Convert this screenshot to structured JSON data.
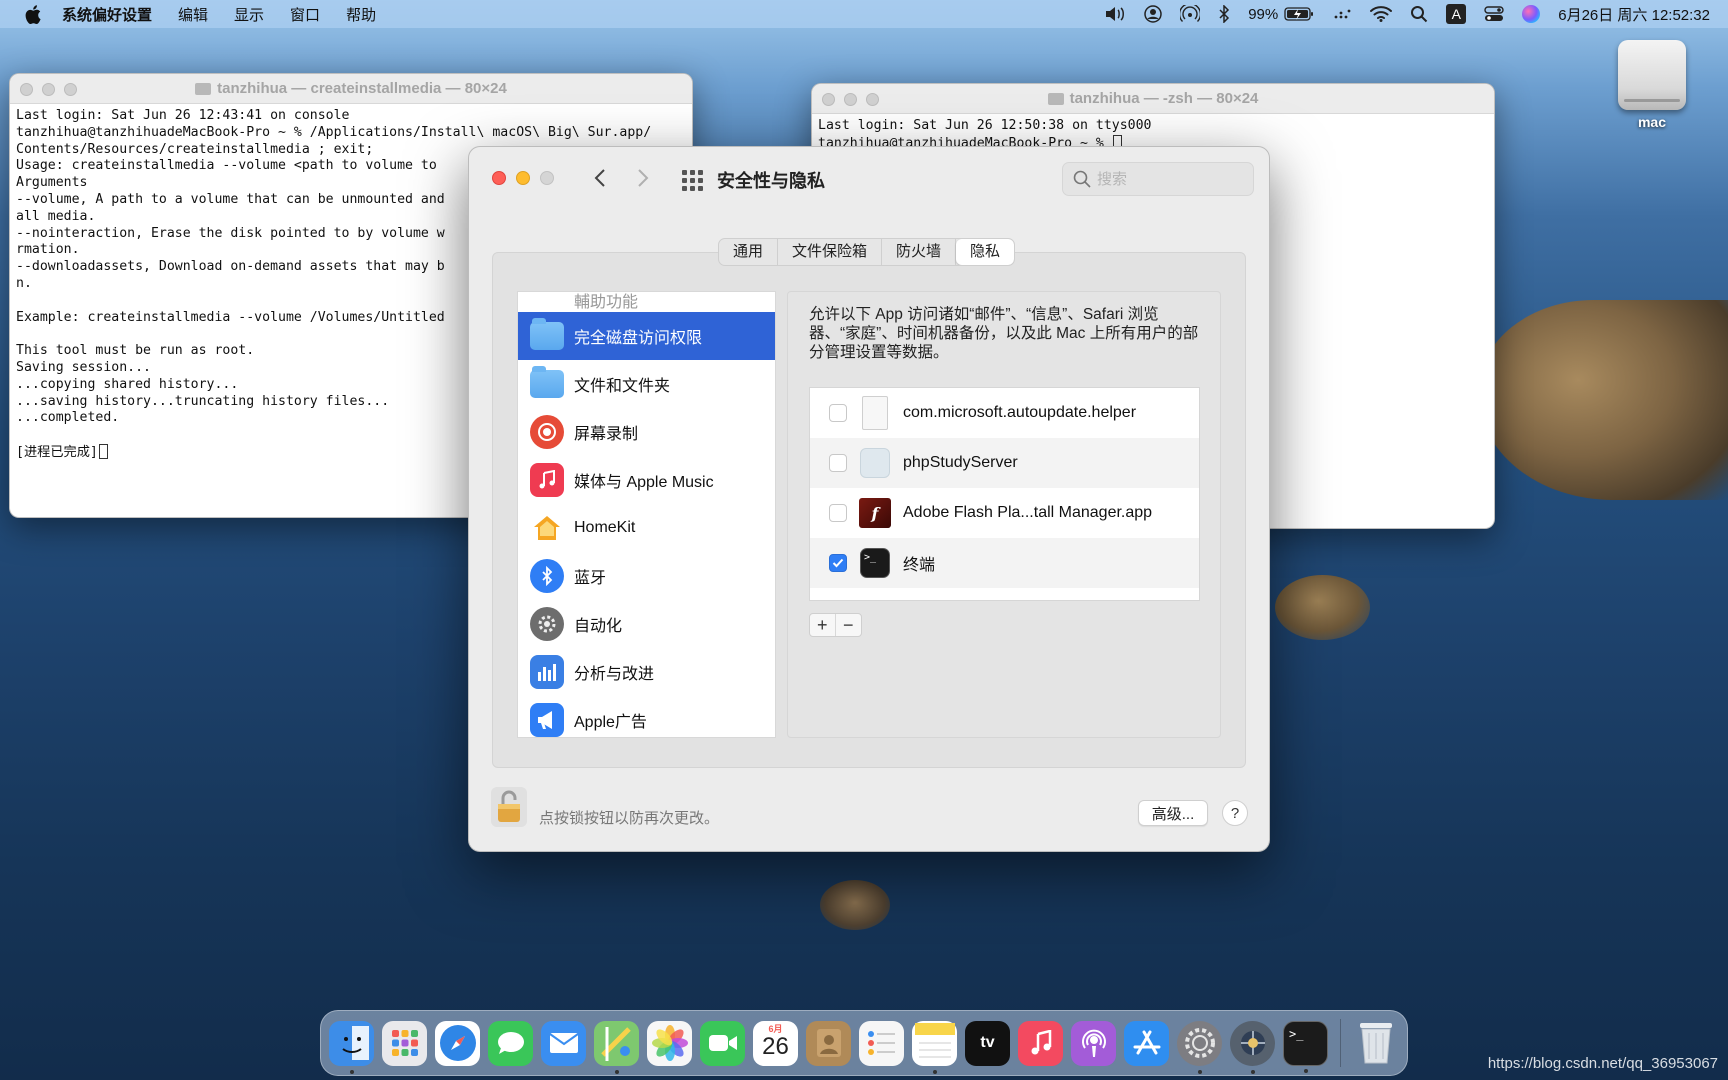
{
  "menubar": {
    "app_name": "系统偏好设置",
    "menus": [
      "编辑",
      "显示",
      "窗口",
      "帮助"
    ],
    "battery": "99%",
    "input_method": "A",
    "clock": "6月26日 周六  12:52:32"
  },
  "desktop": {
    "drive_label": "mac"
  },
  "terminal_left": {
    "title": "tanzhihua — createinstallmedia — 80×24",
    "lines": [
      "Last login: Sat Jun 26 12:43:41 on console",
      "tanzhihua@tanzhihuadeMacBook-Pro ~ % /Applications/Install\\ macOS\\ Big\\ Sur.app/",
      "Contents/Resources/createinstallmedia ; exit;",
      "Usage: createinstallmedia --volume <path to volume to",
      "",
      "Arguments",
      "--volume, A path to a volume that can be unmounted and",
      "all media.",
      "--nointeraction, Erase the disk pointed to by volume w",
      "rmation.",
      "--downloadassets, Download on-demand assets that may b",
      "n.",
      "",
      "Example: createinstallmedia --volume /Volumes/Untitled",
      "",
      "This tool must be run as root.",
      "Saving session...",
      "...copying shared history...",
      "...saving history...truncating history files...",
      "...completed.",
      ""
    ],
    "last_line": "[进程已完成]"
  },
  "terminal_right": {
    "title": "tanzhihua — -zsh — 80×24",
    "lines": [
      "Last login: Sat Jun 26 12:50:38 on ttys000",
      "tanzhihua@tanzhihuadeMacBook-Pro ~ % "
    ]
  },
  "prefs": {
    "title": "安全性与隐私",
    "search_placeholder": "搜索",
    "tabs": [
      "通用",
      "文件保险箱",
      "防火墙",
      "隐私"
    ],
    "active_tab": "隐私",
    "sidebar_partial": "輔助功能",
    "sidebar": [
      {
        "label": "完全磁盘访问权限",
        "icon": "folder-icon",
        "selected": true
      },
      {
        "label": "文件和文件夹",
        "icon": "folder-icon"
      },
      {
        "label": "屏幕录制",
        "icon": "screen-record-icon"
      },
      {
        "label": "媒体与 Apple Music",
        "icon": "music-note-icon"
      },
      {
        "label": "HomeKit",
        "icon": "home-icon"
      },
      {
        "label": "蓝牙",
        "icon": "bluetooth-icon"
      },
      {
        "label": "自动化",
        "icon": "gear-icon"
      },
      {
        "label": "分析与改进",
        "icon": "bar-chart-icon"
      },
      {
        "label": "Apple广告",
        "icon": "megaphone-icon"
      }
    ],
    "description": "允许以下 App 访问诸如“邮件”、“信息”、Safari 浏览器、“家庭”、时间机器备份，以及此 Mac 上所有用户的部分管理设置等数据。",
    "apps": [
      {
        "name": "com.microsoft.autoupdate.helper",
        "checked": false,
        "icon": "document-icon"
      },
      {
        "name": "phpStudyServer",
        "checked": false,
        "icon": "app-grid-icon"
      },
      {
        "name": "Adobe Flash Pla...tall Manager.app",
        "checked": false,
        "icon": "flash-icon"
      },
      {
        "name": "终端",
        "checked": true,
        "icon": "terminal-icon"
      }
    ],
    "plus": "+",
    "minus": "−",
    "lock_text": "点按锁按钮以防再次更改。",
    "advanced_label": "高级...",
    "help_label": "?"
  },
  "dock": {
    "calendar_month": "6月",
    "calendar_day": "26",
    "tv_label": "tv",
    "apps": [
      "finder",
      "launchpad",
      "safari",
      "messages",
      "mail",
      "maps",
      "photos",
      "facetime",
      "calendar",
      "contacts",
      "reminders",
      "notes",
      "apple-tv",
      "music",
      "podcasts",
      "app-store",
      "system-preferences",
      "migration",
      "terminal",
      "trash"
    ],
    "colors": {
      "finder": "#3d8de8",
      "launchpad": "#e9e9ec",
      "safari": "#2f86e6",
      "messages": "#3ac659",
      "mail": "#3a8ef0",
      "maps": "#7ec86f",
      "photos": "#f2f2f2",
      "facetime": "#3ac659",
      "calendar": "#ffffff",
      "contacts": "#b08a58",
      "reminders": "#f6f6f6",
      "notes": "#f8d54a",
      "apple-tv": "#111111",
      "music": "#f34a60",
      "podcasts": "#a35cd8",
      "app-store": "#2f8ef0",
      "system-preferences": "#7d7d82",
      "migration": "#56616e",
      "terminal": "#1b1b1b",
      "trash": "#d9dde2"
    }
  },
  "watermark": "https://blog.csdn.net/qq_36953067"
}
